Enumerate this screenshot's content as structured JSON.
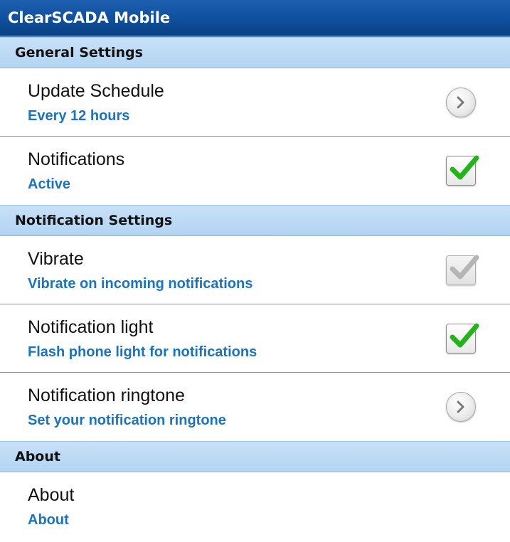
{
  "app": {
    "title": "ClearSCADA Mobile"
  },
  "sections": [
    {
      "header": "General Settings",
      "items": [
        {
          "title": "Update Schedule",
          "subtitle": "Every 12 hours",
          "control": "chevron-right-icon"
        },
        {
          "title": "Notifications",
          "subtitle": "Active",
          "control": "checkbox",
          "checked": true,
          "enabled": true
        }
      ]
    },
    {
      "header": "Notification Settings",
      "items": [
        {
          "title": "Vibrate",
          "subtitle": "Vibrate on incoming notifications",
          "control": "checkbox",
          "checked": true,
          "enabled": false
        },
        {
          "title": "Notification light",
          "subtitle": "Flash phone light for notifications",
          "control": "checkbox",
          "checked": true,
          "enabled": true
        },
        {
          "title": "Notification ringtone",
          "subtitle": "Set your notification ringtone",
          "control": "chevron-right-icon"
        }
      ]
    },
    {
      "header": "About",
      "items": [
        {
          "title": "About",
          "subtitle": "About",
          "control": "none"
        }
      ]
    }
  ],
  "colors": {
    "titlebar": "#0f4f9e",
    "section_header": "#c8e1f7",
    "subtitle_text": "#1a73c2",
    "check_active": "#22b51a",
    "check_disabled": "#b5b5b5"
  }
}
